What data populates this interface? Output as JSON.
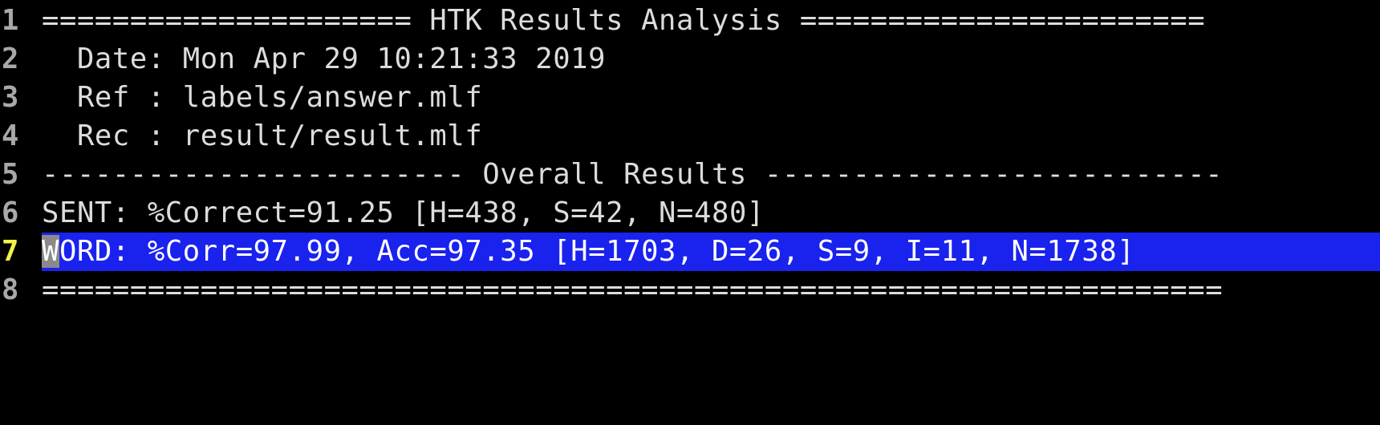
{
  "editor": {
    "lines": [
      {
        "number": "1",
        "text": "===================== HTK Results Analysis ======================="
      },
      {
        "number": "2",
        "text": "  Date: Mon Apr 29 10:21:33 2019"
      },
      {
        "number": "3",
        "text": "  Ref : labels/answer.mlf"
      },
      {
        "number": "4",
        "text": "  Rec : result/result.mlf"
      },
      {
        "number": "5",
        "text": "------------------------ Overall Results --------------------------"
      },
      {
        "number": "6",
        "text": "SENT: %Correct=91.25 [H=438, S=42, N=480]"
      },
      {
        "number": "7",
        "cursor_char": "W",
        "text_after_cursor": "ORD: %Corr=97.99, Acc=97.35 [H=1703, D=26, S=9, I=11, N=1738]"
      },
      {
        "number": "8",
        "text": "==================================================================="
      }
    ]
  },
  "colors": {
    "background": "#000000",
    "text": "#dcdcdc",
    "line_number": "#a8a8a8",
    "current_line_number": "#f2f24a",
    "cursorline_highlight": "#1a22ee",
    "cursor": "#8a8a8a"
  }
}
